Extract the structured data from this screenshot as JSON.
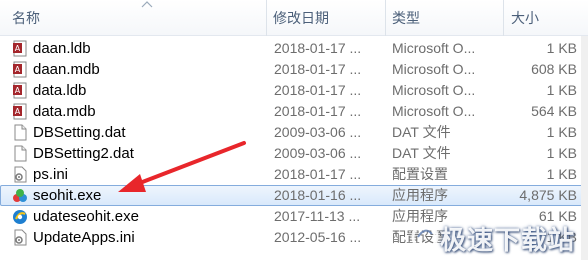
{
  "columns": {
    "name": "名称",
    "date_modified": "修改日期",
    "type": "类型",
    "size": "大小"
  },
  "files": [
    {
      "name": "daan.ldb",
      "date": "2018-01-17 ...",
      "type": "Microsoft O...",
      "size": "1 KB",
      "icon": "access-icon"
    },
    {
      "name": "daan.mdb",
      "date": "2018-01-17 ...",
      "type": "Microsoft O...",
      "size": "608 KB",
      "icon": "access-icon"
    },
    {
      "name": "data.ldb",
      "date": "2018-01-17 ...",
      "type": "Microsoft O...",
      "size": "1 KB",
      "icon": "access-icon"
    },
    {
      "name": "data.mdb",
      "date": "2018-01-17 ...",
      "type": "Microsoft O...",
      "size": "564 KB",
      "icon": "access-icon"
    },
    {
      "name": "DBSetting.dat",
      "date": "2009-03-06 ...",
      "type": "DAT 文件",
      "size": "1 KB",
      "icon": "blank-file-icon"
    },
    {
      "name": "DBSetting2.dat",
      "date": "2009-03-06 ...",
      "type": "DAT 文件",
      "size": "1 KB",
      "icon": "blank-file-icon"
    },
    {
      "name": "ps.ini",
      "date": "2018-01-17 ...",
      "type": "配置设置",
      "size": "1 KB",
      "icon": "settings-file-icon"
    },
    {
      "name": "seohit.exe",
      "date": "2018-01-16 ...",
      "type": "应用程序",
      "size": "4,875 KB",
      "icon": "seohit-app-icon"
    },
    {
      "name": "udateseohit.exe",
      "date": "2017-11-13 ...",
      "type": "应用程序",
      "size": "61 KB",
      "icon": "update-app-icon"
    },
    {
      "name": "UpdateApps.ini",
      "date": "2012-05-16 ...",
      "type": "配置设置",
      "size": "1 KB",
      "icon": "settings-file-icon"
    }
  ],
  "selected_index": 7,
  "watermark": "极速下载站",
  "colors": {
    "selection_border": "#84acdd",
    "arrow": "#e8262b",
    "header_text": "#4c607a",
    "meta_text": "#6d6d6d"
  }
}
